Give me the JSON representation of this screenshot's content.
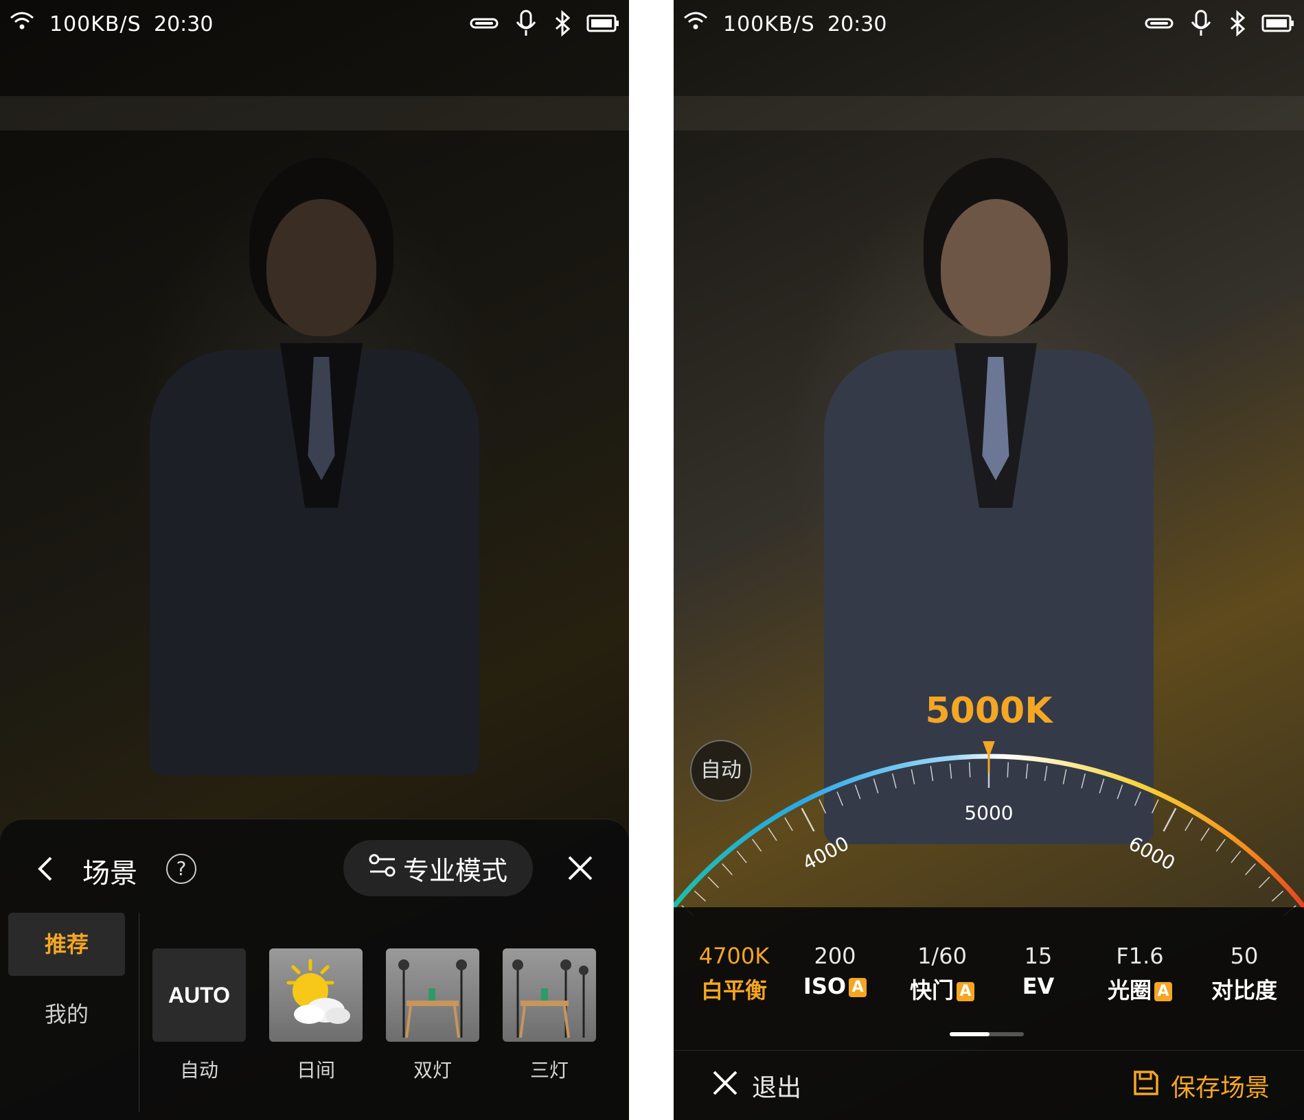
{
  "status_bar": {
    "speed": "100KB/S",
    "time": "20:30"
  },
  "left_screen": {
    "sheet_title": "场景",
    "help_glyph": "?",
    "pro_mode_label": "专业模式",
    "tabs": [
      {
        "label": "推荐",
        "active": true
      },
      {
        "label": "我的",
        "active": false
      }
    ],
    "scenes": [
      {
        "thumb_text": "AUTO",
        "label": "自动"
      },
      {
        "thumb_text": "",
        "label": "日间"
      },
      {
        "thumb_text": "",
        "label": "双灯"
      },
      {
        "thumb_text": "",
        "label": "三灯"
      }
    ]
  },
  "right_screen": {
    "auto_label": "自动",
    "kelvin_readout": "5000K",
    "dial": {
      "min": 3000,
      "max": 7000,
      "current": 5000,
      "tick_labels": [
        "4000",
        "5000",
        "6000"
      ]
    },
    "params": [
      {
        "value": "4700K",
        "label": "白平衡",
        "badge": "",
        "active": true
      },
      {
        "value": "200",
        "label": "ISO",
        "badge": "A",
        "active": false
      },
      {
        "value": "1/60",
        "label": "快门",
        "badge": "A",
        "active": false
      },
      {
        "value": "15",
        "label": "EV",
        "badge": "",
        "active": false
      },
      {
        "value": "F1.6",
        "label": "光圈",
        "badge": "A",
        "active": false
      },
      {
        "value": "50",
        "label": "对比度",
        "badge": "",
        "active": false
      }
    ],
    "exit_label": "退出",
    "save_label": "保存场景"
  },
  "colors": {
    "accent": "#f5a623",
    "panel": "#0a0a0a"
  }
}
